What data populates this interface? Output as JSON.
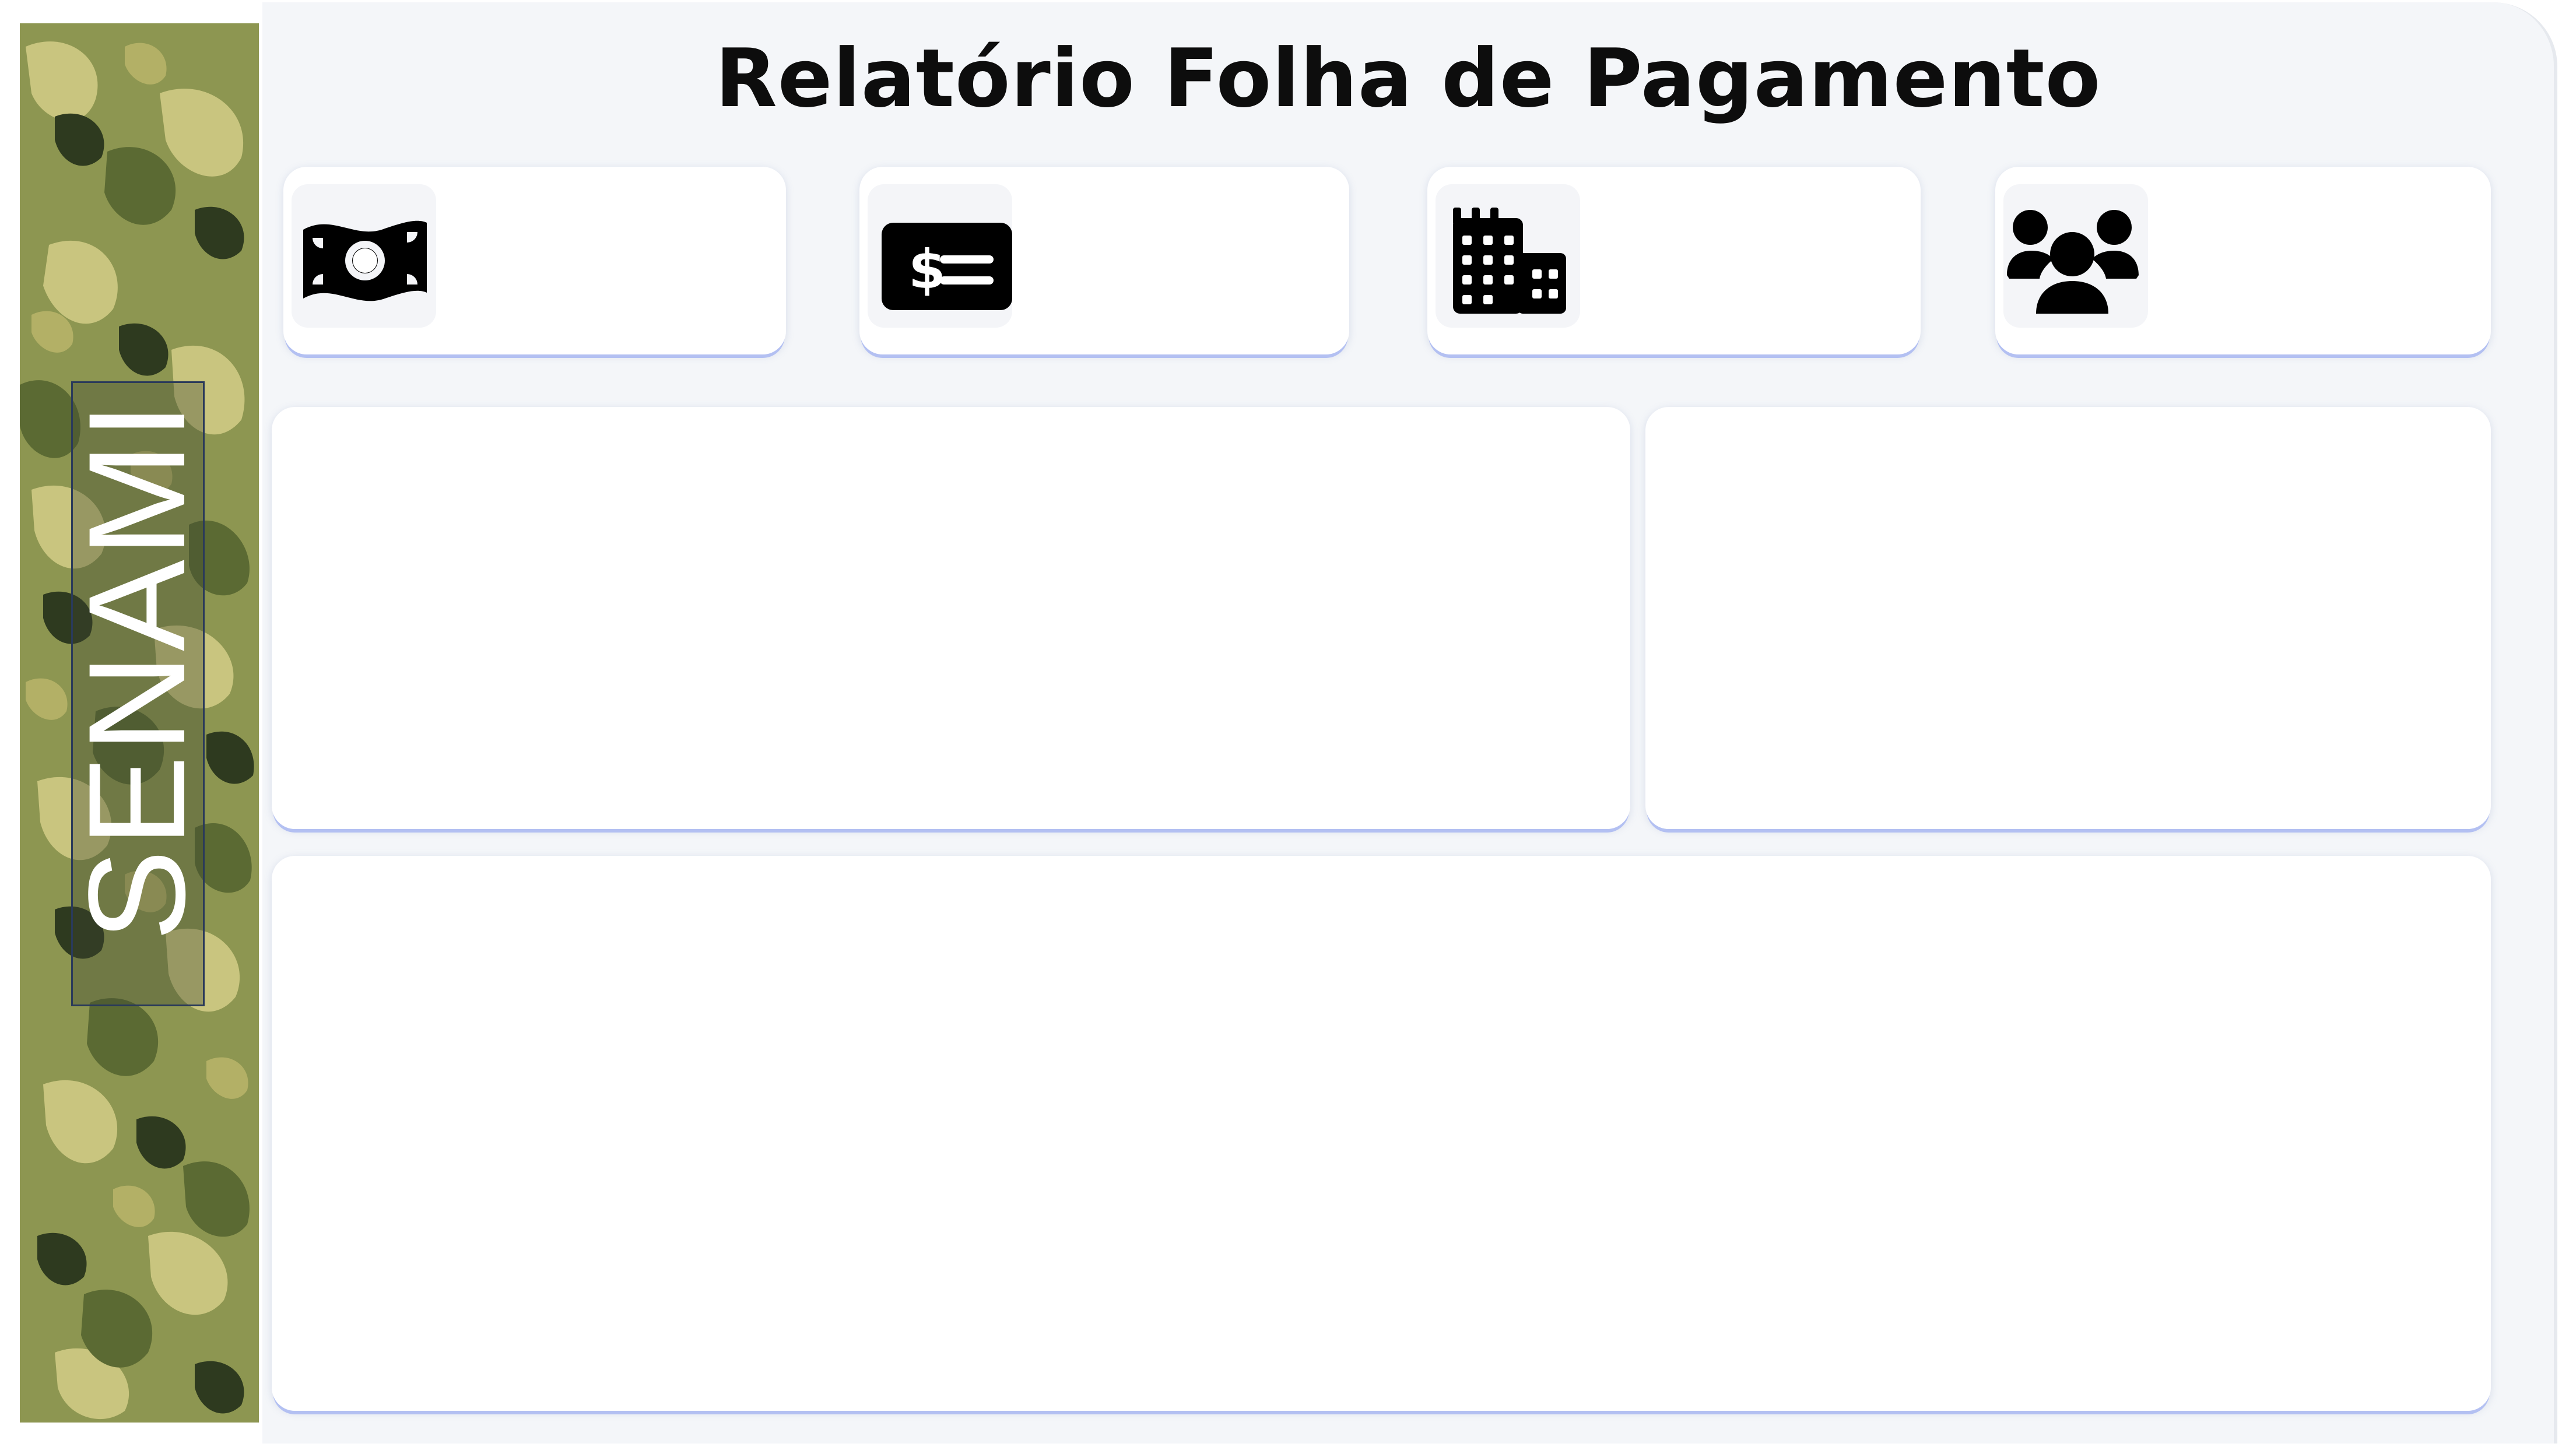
{
  "report": {
    "title": "Relatório Folha de Pagamento",
    "brand": "SENAMI"
  },
  "kpi_cards": [
    {
      "icon": "money-bill-wave-icon"
    },
    {
      "icon": "money-check-dollar-icon"
    },
    {
      "icon": "building-icon"
    },
    {
      "icon": "users-icon"
    }
  ],
  "colors": {
    "panel_background": "#f4f6f9",
    "card_background": "#ffffff",
    "card_accent_shadow": "#b3c0f2",
    "title_text": "#0d0d0d",
    "camo_colors": [
      "#7f8c45",
      "#c9c57f",
      "#4a5a2c",
      "#2c3a1e",
      "#a8aa5e"
    ]
  }
}
